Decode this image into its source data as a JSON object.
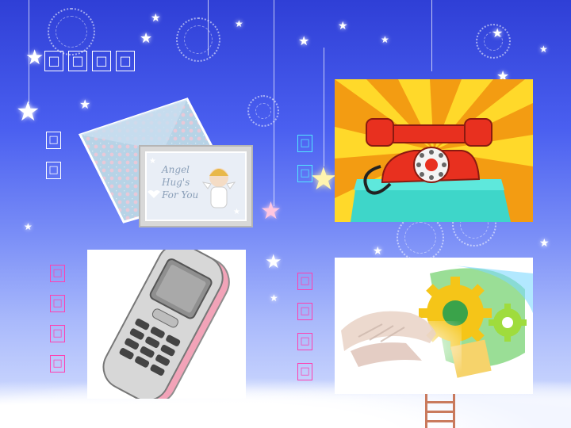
{
  "title": {
    "chars": [
      "□",
      "□",
      "□",
      "□"
    ]
  },
  "labels": {
    "letter": [
      "□",
      "□"
    ],
    "telephone": [
      "□",
      "□"
    ],
    "mobile": [
      "□",
      "□",
      "□",
      "□"
    ],
    "computer": [
      "□",
      "□",
      "□",
      "□"
    ]
  },
  "pictures": {
    "letter": {
      "icon": "letter-envelope-card",
      "card_text": [
        "Angel",
        "Hug's",
        "For You"
      ]
    },
    "telephone": {
      "icon": "red-rotary-telephone"
    },
    "mobile": {
      "icon": "slider-mobile-phone"
    },
    "computer": {
      "icon": "hands-typing-gears"
    }
  },
  "colors": {
    "background_top": "#2f3fd6",
    "background_bottom": "#d9e3ff",
    "title": "#ffffff",
    "label_letter": "#ffffff",
    "label_telephone": "#53e7ff",
    "label_mobile": "#ff3fb0",
    "label_computer": "#ff3fb0",
    "phone_red": "#e8301f",
    "phone_table": "#3ed6c9",
    "sunburst_orange": "#f39c12",
    "sunburst_yellow": "#ffd92a"
  }
}
